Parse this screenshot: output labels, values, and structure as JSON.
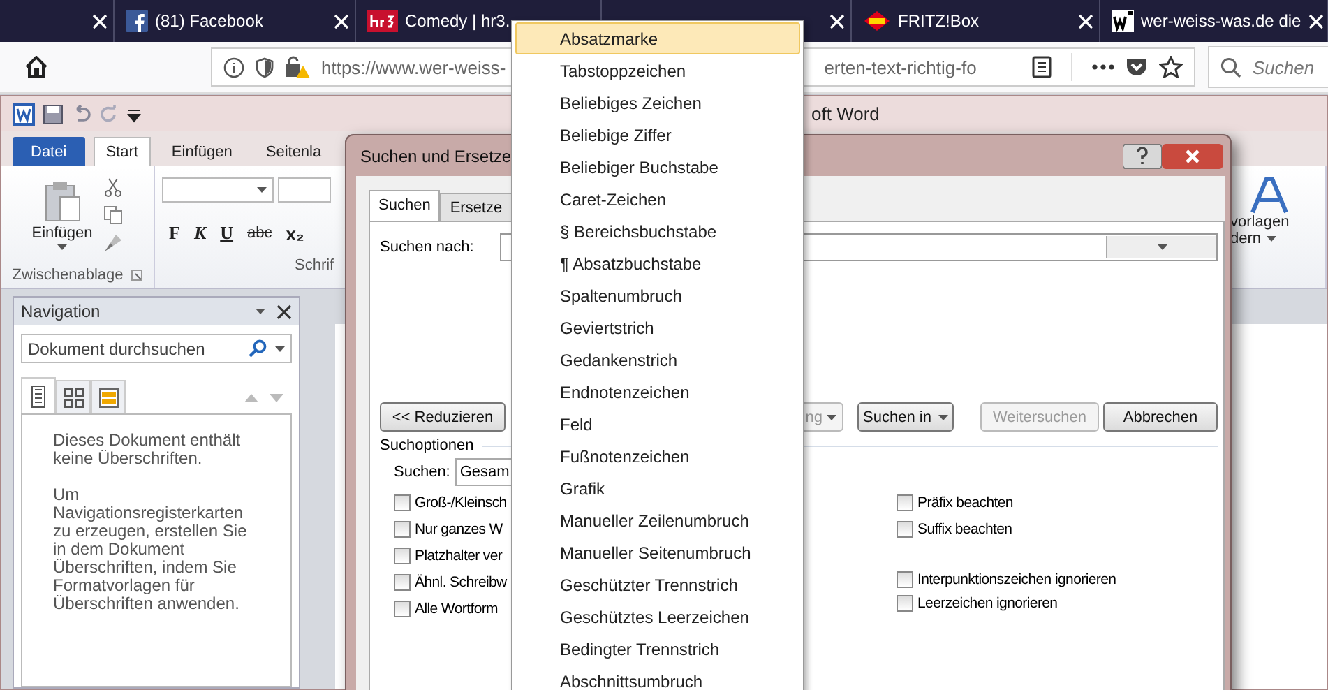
{
  "browser": {
    "tabs": [
      {
        "kind": "blank",
        "closable": true
      },
      {
        "kind": "social",
        "title": "(81) Facebook",
        "closable": true
      },
      {
        "kind": "radio",
        "title": "Comedy | hr3.",
        "closable": false
      },
      {
        "kind": "blank",
        "closable": true
      },
      {
        "kind": "router",
        "title": "FRITZ!Box",
        "closable": true
      },
      {
        "kind": "site",
        "title": "wer-weiss-was.de die",
        "closable": true
      }
    ],
    "url_start": "https://www.wer-weiss-",
    "url_end": "erten-text-richtig-fo",
    "search_placeholder": "Suchen"
  },
  "word": {
    "title": "oft Word",
    "ribbon_tabs": [
      {
        "label": "Datei",
        "kind": "file",
        "selected": false
      },
      {
        "label": "Start",
        "kind": "tab",
        "selected": true
      },
      {
        "label": "Einfügen",
        "kind": "tab",
        "selected": false
      },
      {
        "label": "Seitenla",
        "kind": "tab",
        "selected": false
      }
    ],
    "paste_label": "Einfügen",
    "clipboard_group": "Zwischenablage",
    "font_buttons": [
      {
        "label": "F",
        "kind": "bold"
      },
      {
        "label": "K",
        "kind": "italic"
      },
      {
        "label": "U",
        "kind": "underline"
      },
      {
        "label": "abc",
        "kind": "strike"
      },
      {
        "label": "x₂",
        "kind": "subscript"
      }
    ],
    "font_group": "Schrif",
    "styles_label_1": "vorlagen",
    "styles_label_2": "dern",
    "navigation": {
      "title": "Navigation",
      "search_placeholder": "Dokument durchsuchen",
      "tabs": [
        {
          "kind": "headings",
          "selected": true
        },
        {
          "kind": "pages",
          "selected": false
        },
        {
          "kind": "results",
          "selected": false
        }
      ],
      "message_1": "Dieses Dokument enthält keine Überschriften.",
      "message_2": "Um Navigationsregisterkarten zu erzeugen, erstellen Sie in dem Dokument Überschriften, indem Sie Formatvorlagen für Überschriften anwenden."
    }
  },
  "dialog": {
    "title": "Suchen und Ersetze",
    "tabs": [
      {
        "label": "Suchen",
        "selected": true
      },
      {
        "label": "Ersetze",
        "selected": false
      }
    ],
    "find_label": "Suchen nach:",
    "collapse_button": "<< Reduzieren",
    "buttons": [
      {
        "label": "ng",
        "dropdown": true,
        "disabled": true
      },
      {
        "label": "Suchen in",
        "dropdown": true,
        "disabled": false
      },
      {
        "label": "Weitersuchen",
        "dropdown": false,
        "disabled": true
      },
      {
        "label": "Abbrechen",
        "dropdown": false,
        "disabled": false
      }
    ],
    "options_label": "Suchoptionen",
    "search_label": "Suchen:",
    "search_value": "Gesam",
    "options_left": [
      {
        "label": "Groß-/Kleinsch",
        "checked": false
      },
      {
        "label": "Nur ganzes W",
        "checked": false
      },
      {
        "label": "Platzhalter ver",
        "checked": false
      },
      {
        "label": "Ähnl. Schreibw",
        "checked": false
      },
      {
        "label": "Alle Wortform",
        "checked": false
      }
    ],
    "options_right": [
      {
        "label": "Präfix beachten",
        "checked": false,
        "gap_before": false
      },
      {
        "label": "Suffix beachten",
        "checked": false,
        "gap_before": false
      },
      {
        "label": "Interpunktionszeichen ignorieren",
        "checked": false,
        "gap_before": true
      },
      {
        "label": "Leerzeichen ignorieren",
        "checked": false,
        "gap_before": false
      }
    ]
  },
  "menu": {
    "items": [
      {
        "label": "Absatzmarke",
        "selected": true
      },
      {
        "label": "Tabstoppzeichen",
        "selected": false
      },
      {
        "label": "Beliebiges Zeichen",
        "selected": false
      },
      {
        "label": "Beliebige Ziffer",
        "selected": false
      },
      {
        "label": "Beliebiger Buchstabe",
        "selected": false
      },
      {
        "label": "Caret-Zeichen",
        "selected": false
      },
      {
        "label": "§ Bereichsbuchstabe",
        "selected": false
      },
      {
        "label": "¶ Absatzbuchstabe",
        "selected": false
      },
      {
        "label": "Spaltenumbruch",
        "selected": false
      },
      {
        "label": "Geviertstrich",
        "selected": false
      },
      {
        "label": "Gedankenstrich",
        "selected": false
      },
      {
        "label": "Endnotenzeichen",
        "selected": false
      },
      {
        "label": "Feld",
        "selected": false
      },
      {
        "label": "Fußnotenzeichen",
        "selected": false
      },
      {
        "label": "Grafik",
        "selected": false
      },
      {
        "label": "Manueller Zeilenumbruch",
        "selected": false
      },
      {
        "label": "Manueller Seitenumbruch",
        "selected": false
      },
      {
        "label": "Geschützter Trennstrich",
        "selected": false
      },
      {
        "label": "Geschütztes Leerzeichen",
        "selected": false
      },
      {
        "label": "Bedingter Trennstrich",
        "selected": false
      },
      {
        "label": "Abschnittsumbruch",
        "selected": false
      }
    ]
  }
}
